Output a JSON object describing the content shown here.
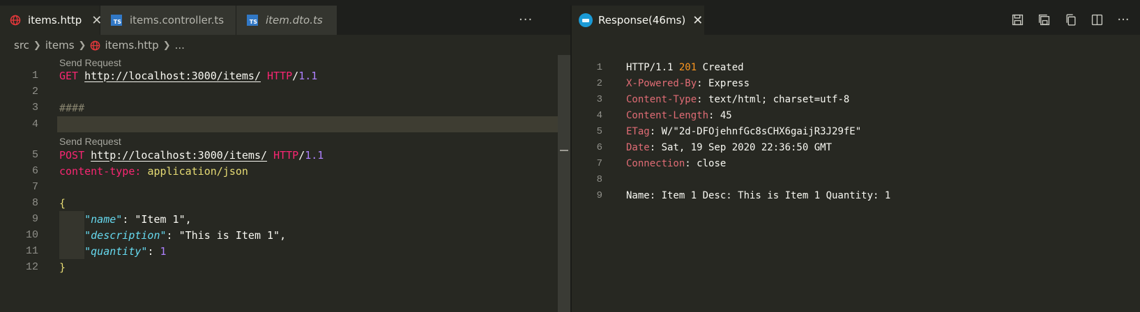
{
  "tabs": [
    {
      "label": "items.http",
      "icon": "globe-icon",
      "active": true,
      "close": "✕"
    },
    {
      "label": "items.controller.ts",
      "icon": "typescript-icon",
      "active": false
    },
    {
      "label": "item.dto.ts",
      "icon": "typescript-icon",
      "active": false,
      "italic": true
    }
  ],
  "ts_badge": "TS",
  "more_actions": "···",
  "breadcrumb": {
    "items": [
      "src",
      "items",
      "items.http",
      "..."
    ]
  },
  "codelens": {
    "send_request": "Send Request"
  },
  "editor": {
    "line_numbers": [
      "1",
      "2",
      "3",
      "4",
      "5",
      "6",
      "7",
      "8",
      "9",
      "10",
      "11",
      "12"
    ],
    "get_method": "GET",
    "get_url": "http://localhost:3000/items/",
    "http_word": "HTTP",
    "slash": "/",
    "http_version": "1.1",
    "separator": "####",
    "post_method": "POST",
    "post_url": "http://localhost:3000/items/",
    "header_name": "content-type:",
    "header_value": "application/json",
    "open_brace": "{",
    "close_brace": "}",
    "body": [
      {
        "key": "\"name\"",
        "value": "\"Item 1\"",
        "trail": ","
      },
      {
        "key": "\"description\"",
        "value": "\"This is Item 1\"",
        "trail": ","
      },
      {
        "key": "\"quantity\"",
        "value": "1",
        "trail": ""
      }
    ],
    "colon": ": "
  },
  "response": {
    "tab_label": "Response(46ms)",
    "close": "✕",
    "line_numbers": [
      "1",
      "2",
      "3",
      "4",
      "5",
      "6",
      "7",
      "8",
      "9"
    ],
    "status": {
      "proto": "HTTP/1.1 ",
      "code": "201",
      "text": " Created"
    },
    "headers": [
      {
        "name": "X-Powered-By",
        "value": ": Express"
      },
      {
        "name": "Content-Type",
        "value": ": text/html; charset=utf-8"
      },
      {
        "name": "Content-Length",
        "value": ": 45"
      },
      {
        "name": "ETag",
        "value": ": W/\"2d-DFOjehnfGc8sCHX6gaijR3J29fE\""
      },
      {
        "name": "Date",
        "value": ": Sat, 19 Sep 2020 22:36:50 GMT"
      },
      {
        "name": "Connection",
        "value": ": close"
      }
    ],
    "body": "Name: Item 1 Desc: This is Item 1 Quantity: 1"
  },
  "colors": {
    "background": "#272822",
    "keyword": "#f92672",
    "string_yellow": "#e6db74",
    "key_cyan": "#66d9ef",
    "number_purple": "#ae81ff",
    "status_orange": "#fd971f"
  }
}
